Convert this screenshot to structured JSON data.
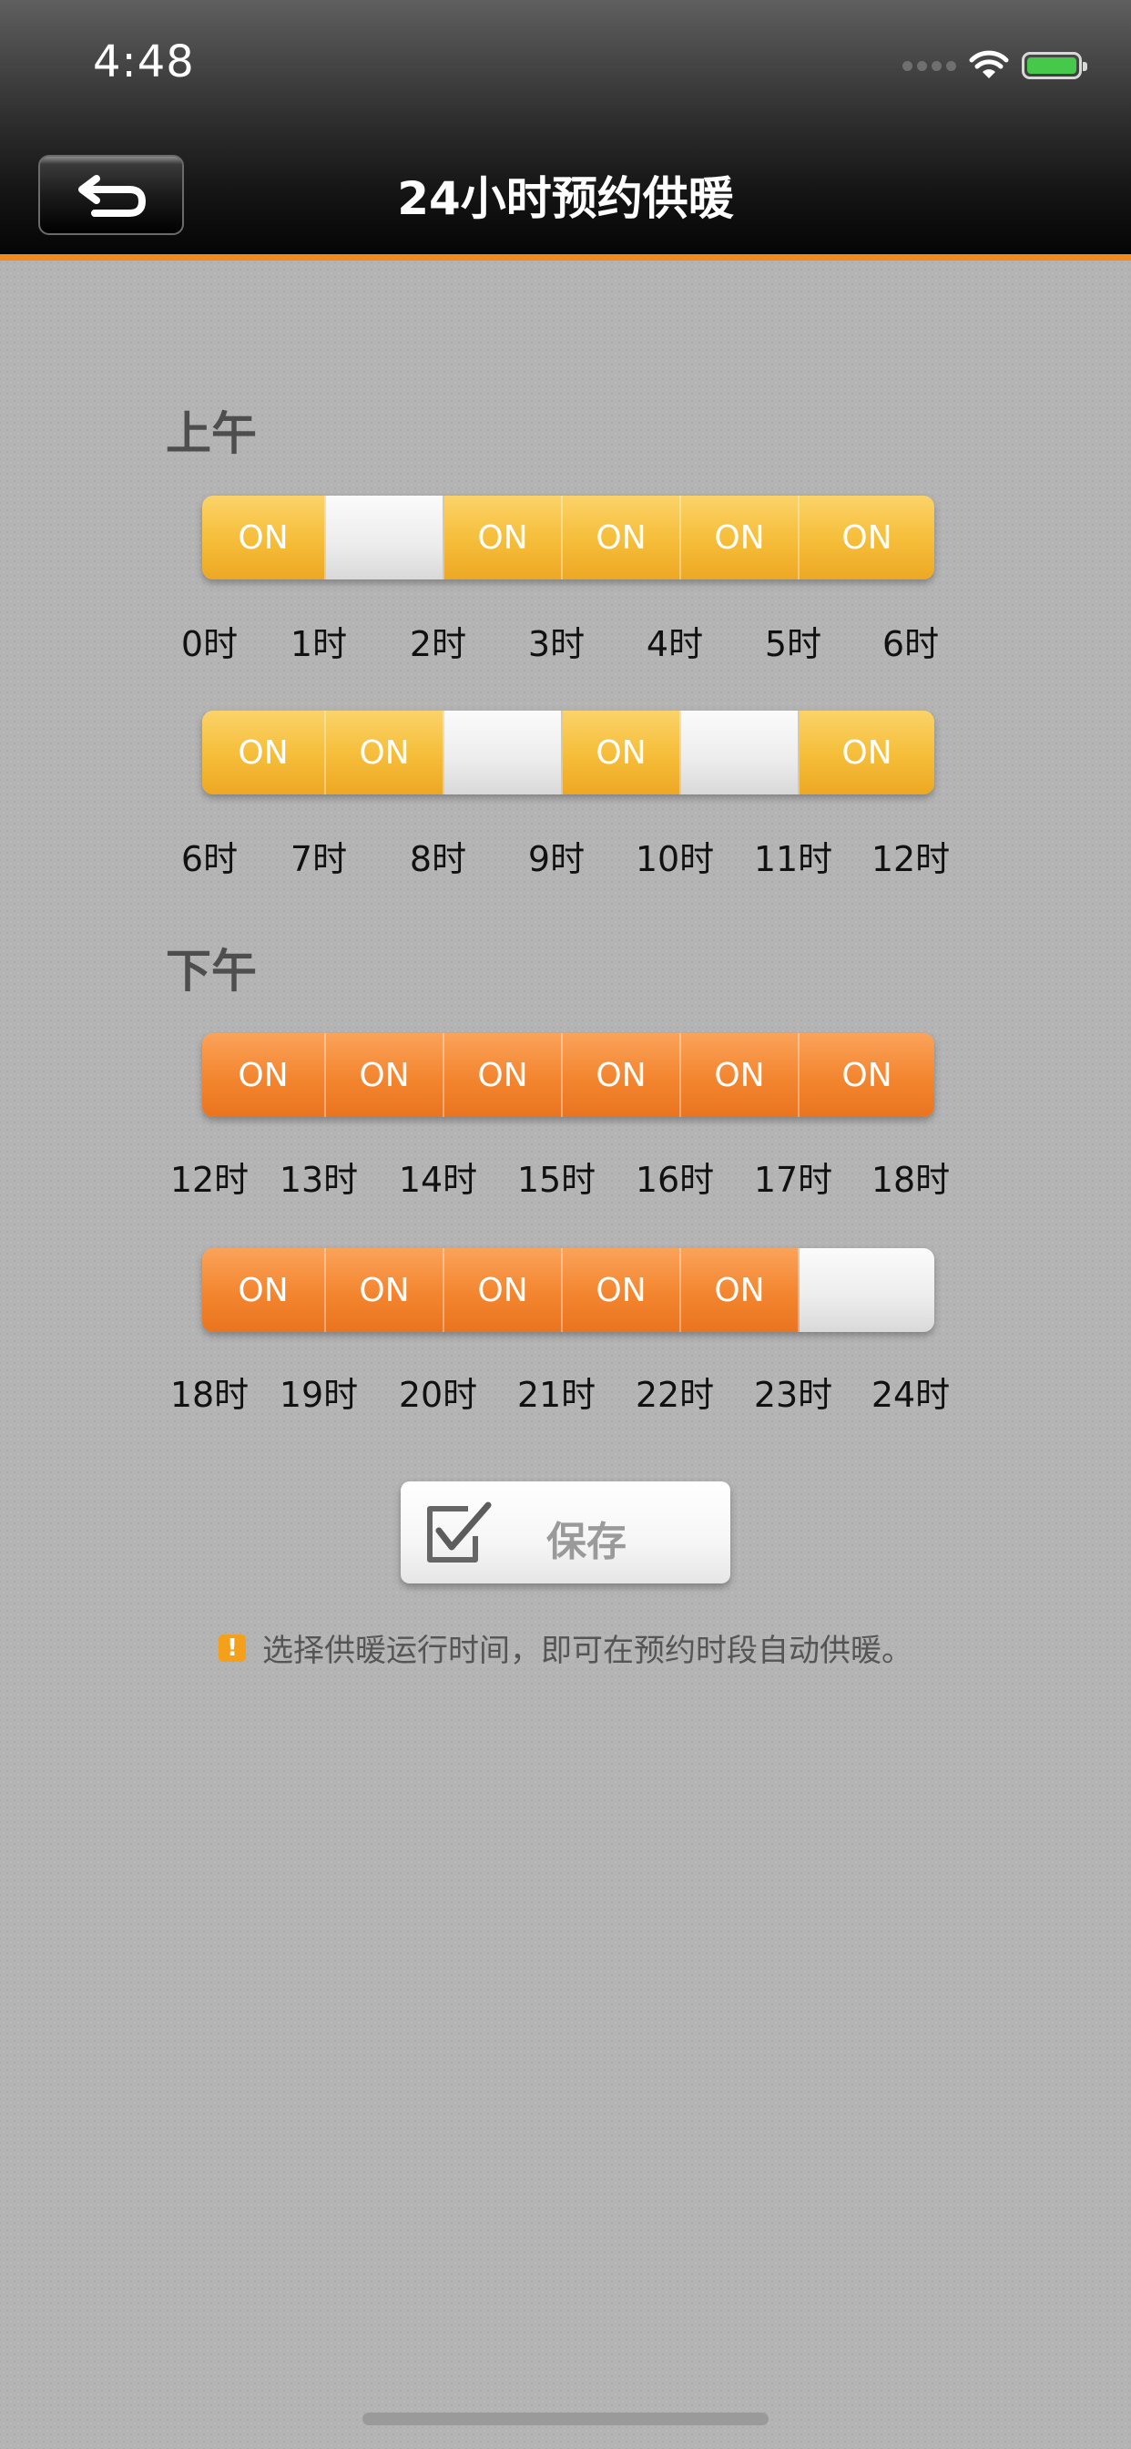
{
  "status_bar": {
    "time": "4:48"
  },
  "header": {
    "title": "24小时预约供暖",
    "back_icon": "return-arrow-icon"
  },
  "am": {
    "label": "上午",
    "rows": [
      {
        "slots": [
          true,
          false,
          true,
          true,
          true,
          true
        ],
        "hours": [
          "0时",
          "1时",
          "2时",
          "3时",
          "4时",
          "5时",
          "6时"
        ]
      },
      {
        "slots": [
          true,
          true,
          false,
          true,
          false,
          true
        ],
        "hours": [
          "6时",
          "7时",
          "8时",
          "9时",
          "10时",
          "11时",
          "12时"
        ]
      }
    ]
  },
  "pm": {
    "label": "下午",
    "rows": [
      {
        "slots": [
          true,
          true,
          true,
          true,
          true,
          true
        ],
        "hours": [
          "12时",
          "13时",
          "14时",
          "15时",
          "16时",
          "17时",
          "18时"
        ]
      },
      {
        "slots": [
          true,
          true,
          true,
          true,
          true,
          false
        ],
        "hours": [
          "18时",
          "19时",
          "20时",
          "21时",
          "22时",
          "23时",
          "24时"
        ]
      }
    ]
  },
  "toggle_on_text": "ON",
  "save_button": {
    "label": "保存",
    "icon": "checkbox-check-icon"
  },
  "hint": {
    "icon": "warning-icon",
    "text": "选择供暖运行时间，即可在预约时段自动供暖。"
  },
  "colors": {
    "accent_orange": "#f28a1d",
    "am_on": "#f6bf3c",
    "pm_on": "#f3852f",
    "warning": "#f5a01b"
  }
}
